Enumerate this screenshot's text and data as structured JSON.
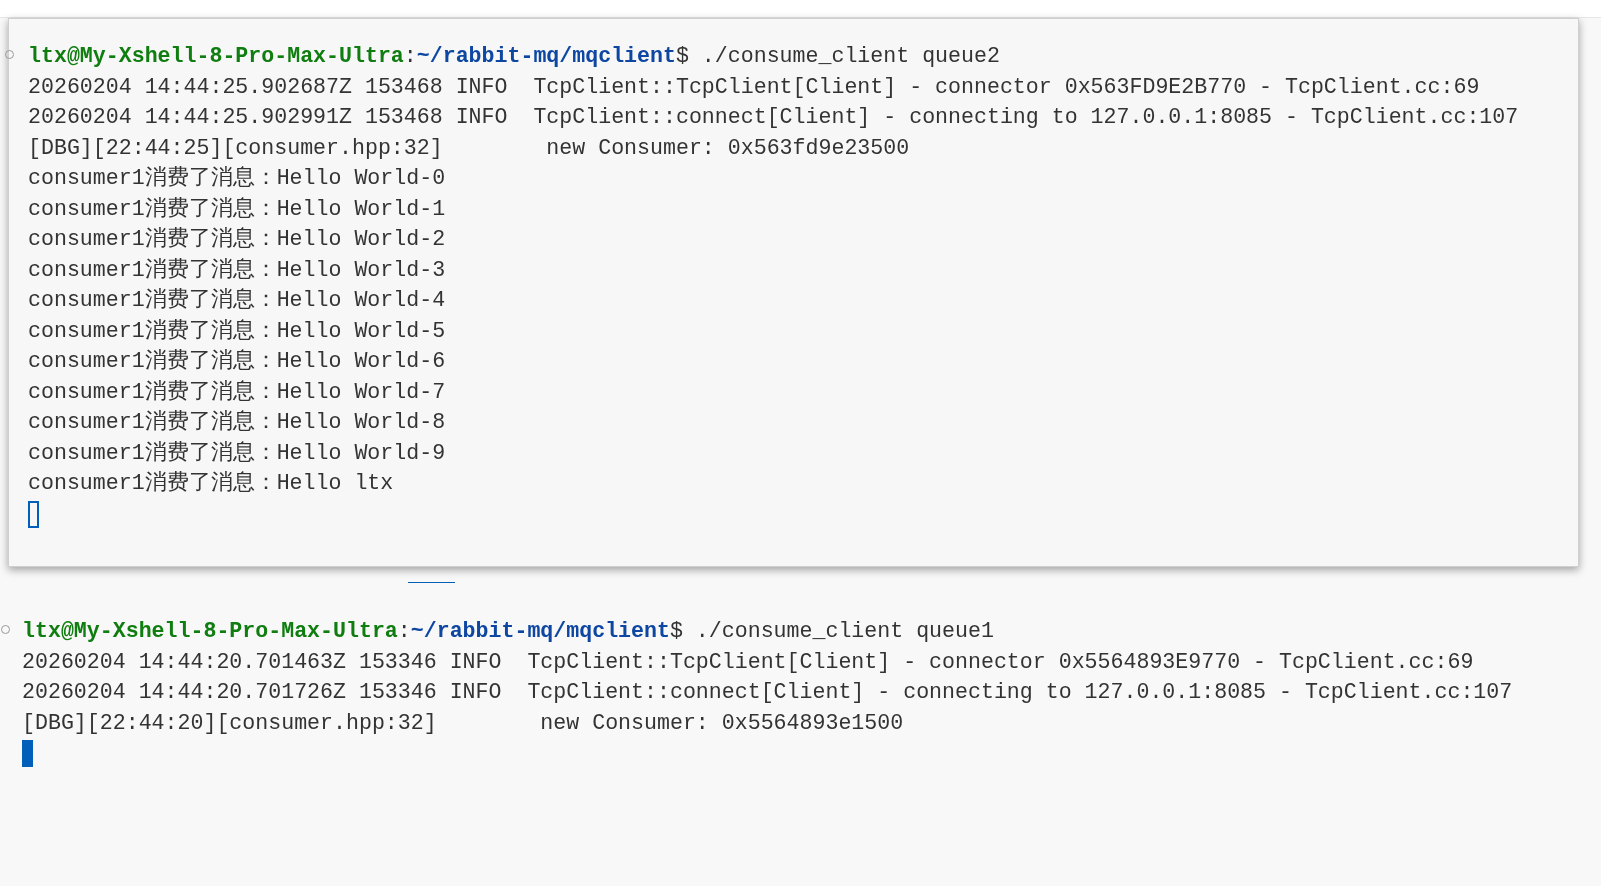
{
  "terminals": [
    {
      "lines": [
        {
          "kind": "prompt",
          "segments": [
            {
              "kind": "host",
              "text": "ltx@My-Xshell-8-Pro-Max-Ultra"
            },
            {
              "kind": "plain",
              "text": ":"
            },
            {
              "kind": "path",
              "text": "~/rabbit-mq/mqclient"
            },
            {
              "kind": "plain",
              "text": "$ ./consume_client queue2"
            }
          ]
        },
        {
          "kind": "output",
          "text": "20260204 14:44:25.902687Z 153468 INFO  TcpClient::TcpClient[Client] - connector 0x563FD9E2B770 - TcpClient.cc:69"
        },
        {
          "kind": "output",
          "text": "20260204 14:44:25.902991Z 153468 INFO  TcpClient::connect[Client] - connecting to 127.0.0.1:8085 - TcpClient.cc:107"
        },
        {
          "kind": "output",
          "text": "[DBG][22:44:25][consumer.hpp:32]        new Consumer: 0x563fd9e23500"
        },
        {
          "kind": "output",
          "text": "consumer1消费了消息：Hello World-0"
        },
        {
          "kind": "output",
          "text": "consumer1消费了消息：Hello World-1"
        },
        {
          "kind": "output",
          "text": "consumer1消费了消息：Hello World-2"
        },
        {
          "kind": "output",
          "text": "consumer1消费了消息：Hello World-3"
        },
        {
          "kind": "output",
          "text": "consumer1消费了消息：Hello World-4"
        },
        {
          "kind": "output",
          "text": "consumer1消费了消息：Hello World-5"
        },
        {
          "kind": "output",
          "text": "consumer1消费了消息：Hello World-6"
        },
        {
          "kind": "output",
          "text": "consumer1消费了消息：Hello World-7"
        },
        {
          "kind": "output",
          "text": "consumer1消费了消息：Hello World-8"
        },
        {
          "kind": "output",
          "text": "consumer1消费了消息：Hello World-9"
        },
        {
          "kind": "output",
          "text": "consumer1消费了消息：Hello ltx"
        }
      ],
      "focused": false
    },
    {
      "lines": [
        {
          "kind": "prompt",
          "segments": [
            {
              "kind": "host",
              "text": "ltx@My-Xshell-8-Pro-Max-Ultra"
            },
            {
              "kind": "plain",
              "text": ":"
            },
            {
              "kind": "path",
              "text": "~/rabbit-mq/mqclient"
            },
            {
              "kind": "plain",
              "text": "$ ./consume_client queue1"
            }
          ]
        },
        {
          "kind": "output",
          "text": "20260204 14:44:20.701463Z 153346 INFO  TcpClient::TcpClient[Client] - connector 0x5564893E9770 - TcpClient.cc:69"
        },
        {
          "kind": "output",
          "text": "20260204 14:44:20.701726Z 153346 INFO  TcpClient::connect[Client] - connecting to 127.0.0.1:8085 - TcpClient.cc:107"
        },
        {
          "kind": "output",
          "text": "[DBG][22:44:20][consumer.hpp:32]        new Consumer: 0x5564893e1500"
        }
      ],
      "focused": true
    }
  ]
}
